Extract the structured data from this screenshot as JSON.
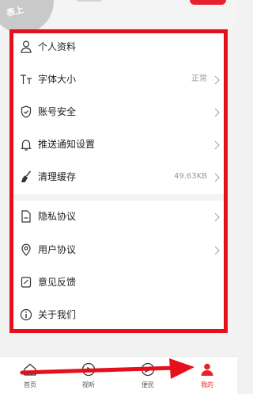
{
  "header": {
    "avatar_text": "表上"
  },
  "menu": {
    "items": [
      {
        "label": "个人资料",
        "icon": "person-icon",
        "value": "",
        "chevron": false
      },
      {
        "label": "字体大小",
        "icon": "font-size-icon",
        "value": "正常",
        "chevron": true
      },
      {
        "label": "账号安全",
        "icon": "shield-check-icon",
        "value": "",
        "chevron": true
      },
      {
        "label": "推送通知设置",
        "icon": "bell-icon",
        "value": "",
        "chevron": true
      },
      {
        "label": "清理缓存",
        "icon": "broom-icon",
        "value": "49.63KB",
        "chevron": true
      },
      {
        "label": "隐私协议",
        "icon": "document-icon",
        "value": "",
        "chevron": true
      },
      {
        "label": "用户协议",
        "icon": "location-pin-icon",
        "value": "",
        "chevron": true
      },
      {
        "label": "意见反馈",
        "icon": "edit-feedback-icon",
        "value": "",
        "chevron": false
      },
      {
        "label": "关于我们",
        "icon": "info-icon",
        "value": "",
        "chevron": false
      }
    ]
  },
  "bottom_nav": {
    "items": [
      {
        "label": "首页",
        "icon": "home-icon",
        "active": false
      },
      {
        "label": "视听",
        "icon": "play-icon",
        "active": false
      },
      {
        "label": "便民",
        "icon": "compass-icon",
        "active": false
      },
      {
        "label": "我的",
        "icon": "user-icon",
        "active": true
      }
    ]
  },
  "colors": {
    "accent": "#e8212c",
    "highlight": "#e60f1c"
  }
}
